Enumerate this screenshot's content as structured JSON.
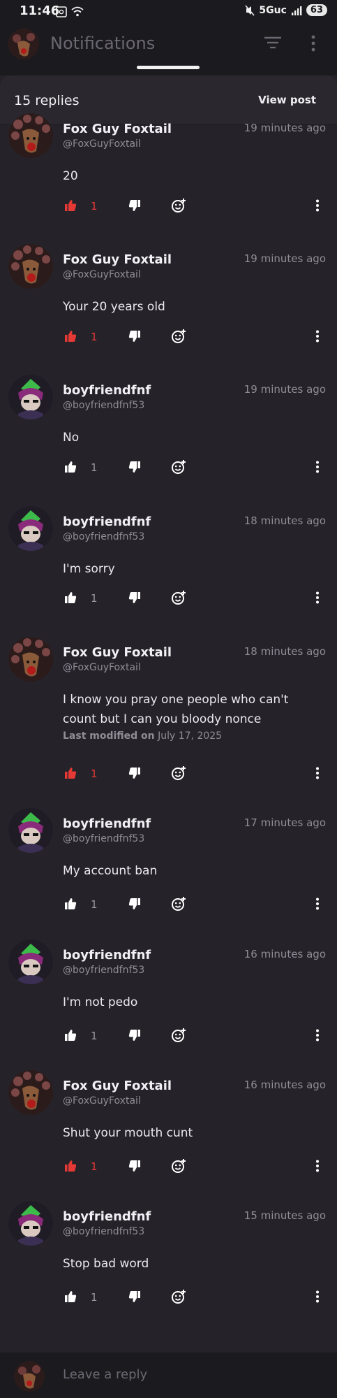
{
  "status": {
    "time": "11:46",
    "network": "5Guc",
    "battery": "63"
  },
  "header": {
    "title": "Notifications"
  },
  "thread": {
    "replies_label": "15 replies",
    "view_post_label": "View post"
  },
  "colors": {
    "liked": "#e53935",
    "neutral": "#bfbcc4",
    "avatar_fox": "#5a2a2a",
    "avatar_bf": "#2f2a3a"
  },
  "comments": [
    {
      "author": "Fox Guy Foxtail",
      "handle": "@FoxGuyFoxtail",
      "time": "19 minutes ago",
      "text": "20",
      "likes": "1",
      "liked": true,
      "avatar": "fox-avatar"
    },
    {
      "author": "Fox Guy Foxtail",
      "handle": "@FoxGuyFoxtail",
      "time": "19 minutes ago",
      "text": "Your 20 years old",
      "likes": "1",
      "liked": true,
      "avatar": "fox-avatar"
    },
    {
      "author": "boyfriendfnf",
      "handle": "@boyfriendfnf53",
      "time": "19 minutes ago",
      "text": "No",
      "likes": "1",
      "liked": false,
      "avatar": "bf-avatar"
    },
    {
      "author": "boyfriendfnf",
      "handle": "@boyfriendfnf53",
      "time": "18 minutes ago",
      "text": "I'm sorry",
      "likes": "1",
      "liked": false,
      "avatar": "bf-avatar"
    },
    {
      "author": "Fox Guy Foxtail",
      "handle": "@FoxGuyFoxtail",
      "time": "18 minutes ago",
      "text": "I know you pray one people who can't count but I can you bloody nonce",
      "modified_label": "Last modified on",
      "modified_date": "July 17, 2025",
      "likes": "1",
      "liked": true,
      "avatar": "fox-avatar"
    },
    {
      "author": "boyfriendfnf",
      "handle": "@boyfriendfnf53",
      "time": "17 minutes ago",
      "text": "My account ban",
      "likes": "1",
      "liked": false,
      "avatar": "bf-avatar"
    },
    {
      "author": "boyfriendfnf",
      "handle": "@boyfriendfnf53",
      "time": "16 minutes ago",
      "text": "I'm not pedo",
      "likes": "1",
      "liked": false,
      "avatar": "bf-avatar"
    },
    {
      "author": "Fox Guy Foxtail",
      "handle": "@FoxGuyFoxtail",
      "time": "16 minutes ago",
      "text": "Shut your mouth cunt",
      "likes": "1",
      "liked": true,
      "avatar": "fox-avatar"
    },
    {
      "author": "boyfriendfnf",
      "handle": "@boyfriendfnf53",
      "time": "15 minutes ago",
      "text": "Stop bad word",
      "likes": "1",
      "liked": false,
      "avatar": "bf-avatar"
    }
  ],
  "reply_bar": {
    "placeholder": "Leave a reply"
  }
}
